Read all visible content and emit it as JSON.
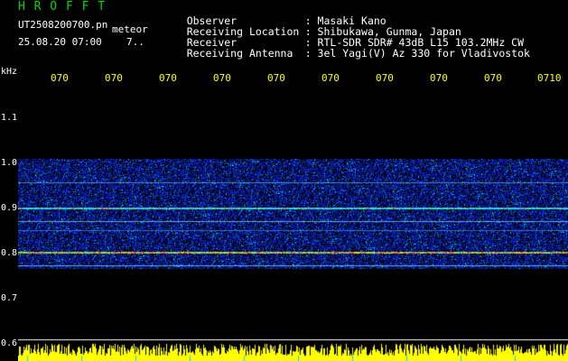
{
  "header": {
    "title_letters": "H R O F F T",
    "filename": "UT2508200700.pn",
    "type_label": "meteor",
    "datetime": "25.08.20 07:00",
    "trail": "7..",
    "info": [
      {
        "label": "Observer",
        "value": ": Masaki Kano"
      },
      {
        "label": "Receiving Location",
        "value": ": Shibukawa, Gunma, Japan"
      },
      {
        "label": "Receiver",
        "value": ": RTL-SDR SDR# 43dB L15 103.2MHz CW"
      },
      {
        "label": "Receiving Antenna",
        "value": ": 3el Yagi(V) Az 330 for Vladivostok"
      }
    ]
  },
  "axis": {
    "unit": "kHz",
    "time_ticks": [
      "070",
      "070",
      "070",
      "070",
      "070",
      "070",
      "070",
      "070",
      "070",
      "0710"
    ],
    "freq_ticks": [
      "1.1",
      "1.0",
      "0.9",
      "0.8",
      "0.7",
      "0.6"
    ]
  },
  "colors": {
    "header_green": "#00d800",
    "tick_yellow": "#ffff00",
    "axis_text": "#ffffff",
    "background": "#000000",
    "noise_blue": "#0a3cff",
    "signal_red": "#ff2a2a",
    "bar_yellow": "#ffff00"
  }
}
